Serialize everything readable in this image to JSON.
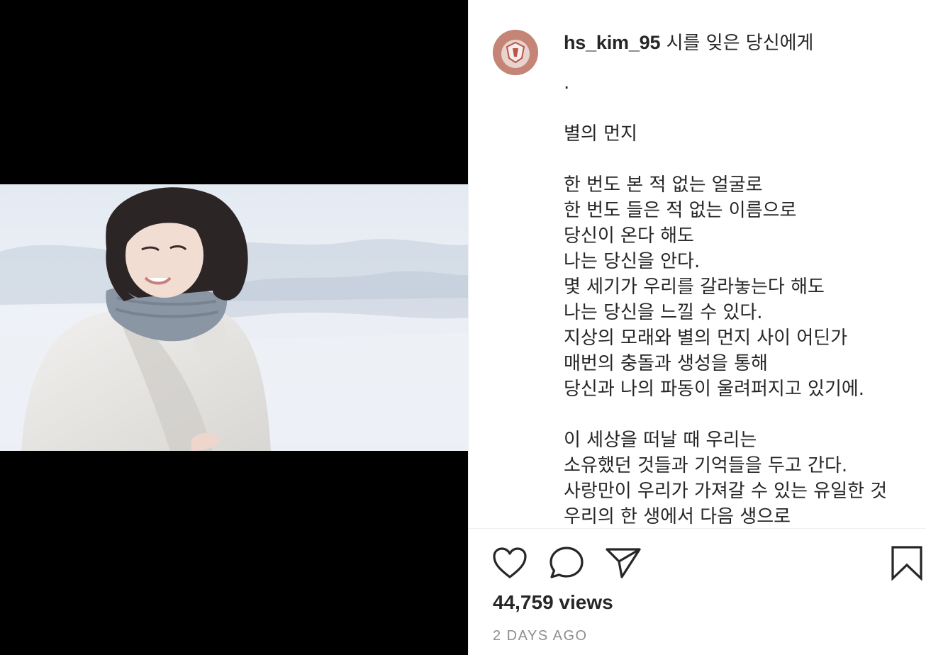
{
  "post": {
    "username": "hs_kim_95",
    "caption_title": "시를 잊은 당신에게",
    "caption_lines": [
      ".",
      "",
      "별의 먼지",
      "",
      "한 번도 본 적 없는 얼굴로",
      "한 번도 들은 적 없는 이름으로",
      "당신이 온다 해도",
      "나는 당신을 안다.",
      "몇 세기가 우리를 갈라놓는다 해도",
      "나는 당신을 느낄 수 있다.",
      "지상의 모래와 별의 먼지 사이 어딘가",
      "매번의 충돌과 생성을 통해",
      "당신과 나의 파동이 울려퍼지고 있기에.",
      "",
      "이 세상을 떠날 때 우리는",
      "소유했던 것들과 기억들을 두고 간다.",
      "사랑만이 우리가 가져갈 수 있는 유일한 것",
      "우리의 한 생에서 다음 생으로"
    ],
    "views": "44,759 views",
    "timestamp": "2 DAYS AGO"
  },
  "actions": {
    "like_icon": "heart-icon",
    "comment_icon": "comment-bubble-icon",
    "share_icon": "paper-plane-icon",
    "save_icon": "bookmark-icon"
  },
  "colors": {
    "text": "#262626",
    "muted": "#8e8e8e",
    "divider": "#efefef",
    "media_background": "#000000"
  }
}
